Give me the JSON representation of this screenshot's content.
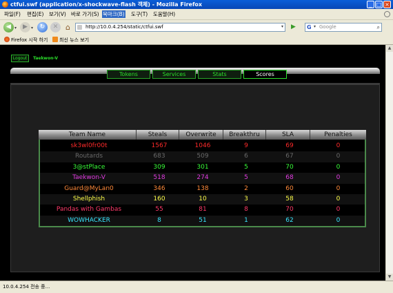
{
  "window": {
    "title": "ctfui.swf (application/x-shockwave-flash 객체) - Mozilla Firefox",
    "controls": [
      "_",
      "□",
      "×"
    ]
  },
  "menubar": {
    "items": [
      "파일(F)",
      "편집(E)",
      "보기(V)",
      "바로 가기(S)",
      "북마크(B)",
      "도구(T)",
      "도움말(H)"
    ],
    "active_index": 4
  },
  "navbar": {
    "url": "http://10.0.4.254/static/ctfui.swf",
    "search_placeholder": "Google"
  },
  "bookmarks": {
    "items": [
      "Firefox 시작 하기",
      "최신 뉴스 보기"
    ]
  },
  "app": {
    "logout_label": "Logout",
    "team_name": "Taekwon-V",
    "tabs": [
      "Tokens",
      "Services",
      "Stats",
      "Scores"
    ],
    "active_tab_index": 3,
    "scores_table": {
      "headers": [
        "Team Name",
        "Steals",
        "Overwrite",
        "Breakthru",
        "SLA",
        "Penalties"
      ],
      "rows": [
        {
          "team": "sk3wl0fr00t",
          "steals": "1567",
          "overwrite": "1046",
          "breakthru": "9",
          "sla": "69",
          "penalties": "0",
          "color": "#ff2a2a"
        },
        {
          "team": "Routards",
          "steals": "683",
          "overwrite": "509",
          "breakthru": "6",
          "sla": "67",
          "penalties": "0",
          "color": "#6a6a6a"
        },
        {
          "team": "3@stPlace",
          "steals": "309",
          "overwrite": "301",
          "breakthru": "5",
          "sla": "70",
          "penalties": "0",
          "color": "#39ff39"
        },
        {
          "team": "Taekwon-V",
          "steals": "518",
          "overwrite": "274",
          "breakthru": "5",
          "sla": "68",
          "penalties": "0",
          "color": "#e03be0"
        },
        {
          "team": "Guard@MyLan0",
          "steals": "346",
          "overwrite": "138",
          "breakthru": "2",
          "sla": "60",
          "penalties": "0",
          "color": "#ff8a3a"
        },
        {
          "team": "Shellphish",
          "steals": "160",
          "overwrite": "10",
          "breakthru": "3",
          "sla": "58",
          "penalties": "0",
          "color": "#ffff4a"
        },
        {
          "team": "Pandas with Gambas",
          "steals": "55",
          "overwrite": "81",
          "breakthru": "8",
          "sla": "70",
          "penalties": "0",
          "color": "#ff3a6a"
        },
        {
          "team": "WOWHACKER",
          "steals": "8",
          "overwrite": "51",
          "breakthru": "1",
          "sla": "62",
          "penalties": "0",
          "color": "#3ae6ff"
        }
      ]
    }
  },
  "status": {
    "text": "10.0.4.254 전송 중..."
  }
}
